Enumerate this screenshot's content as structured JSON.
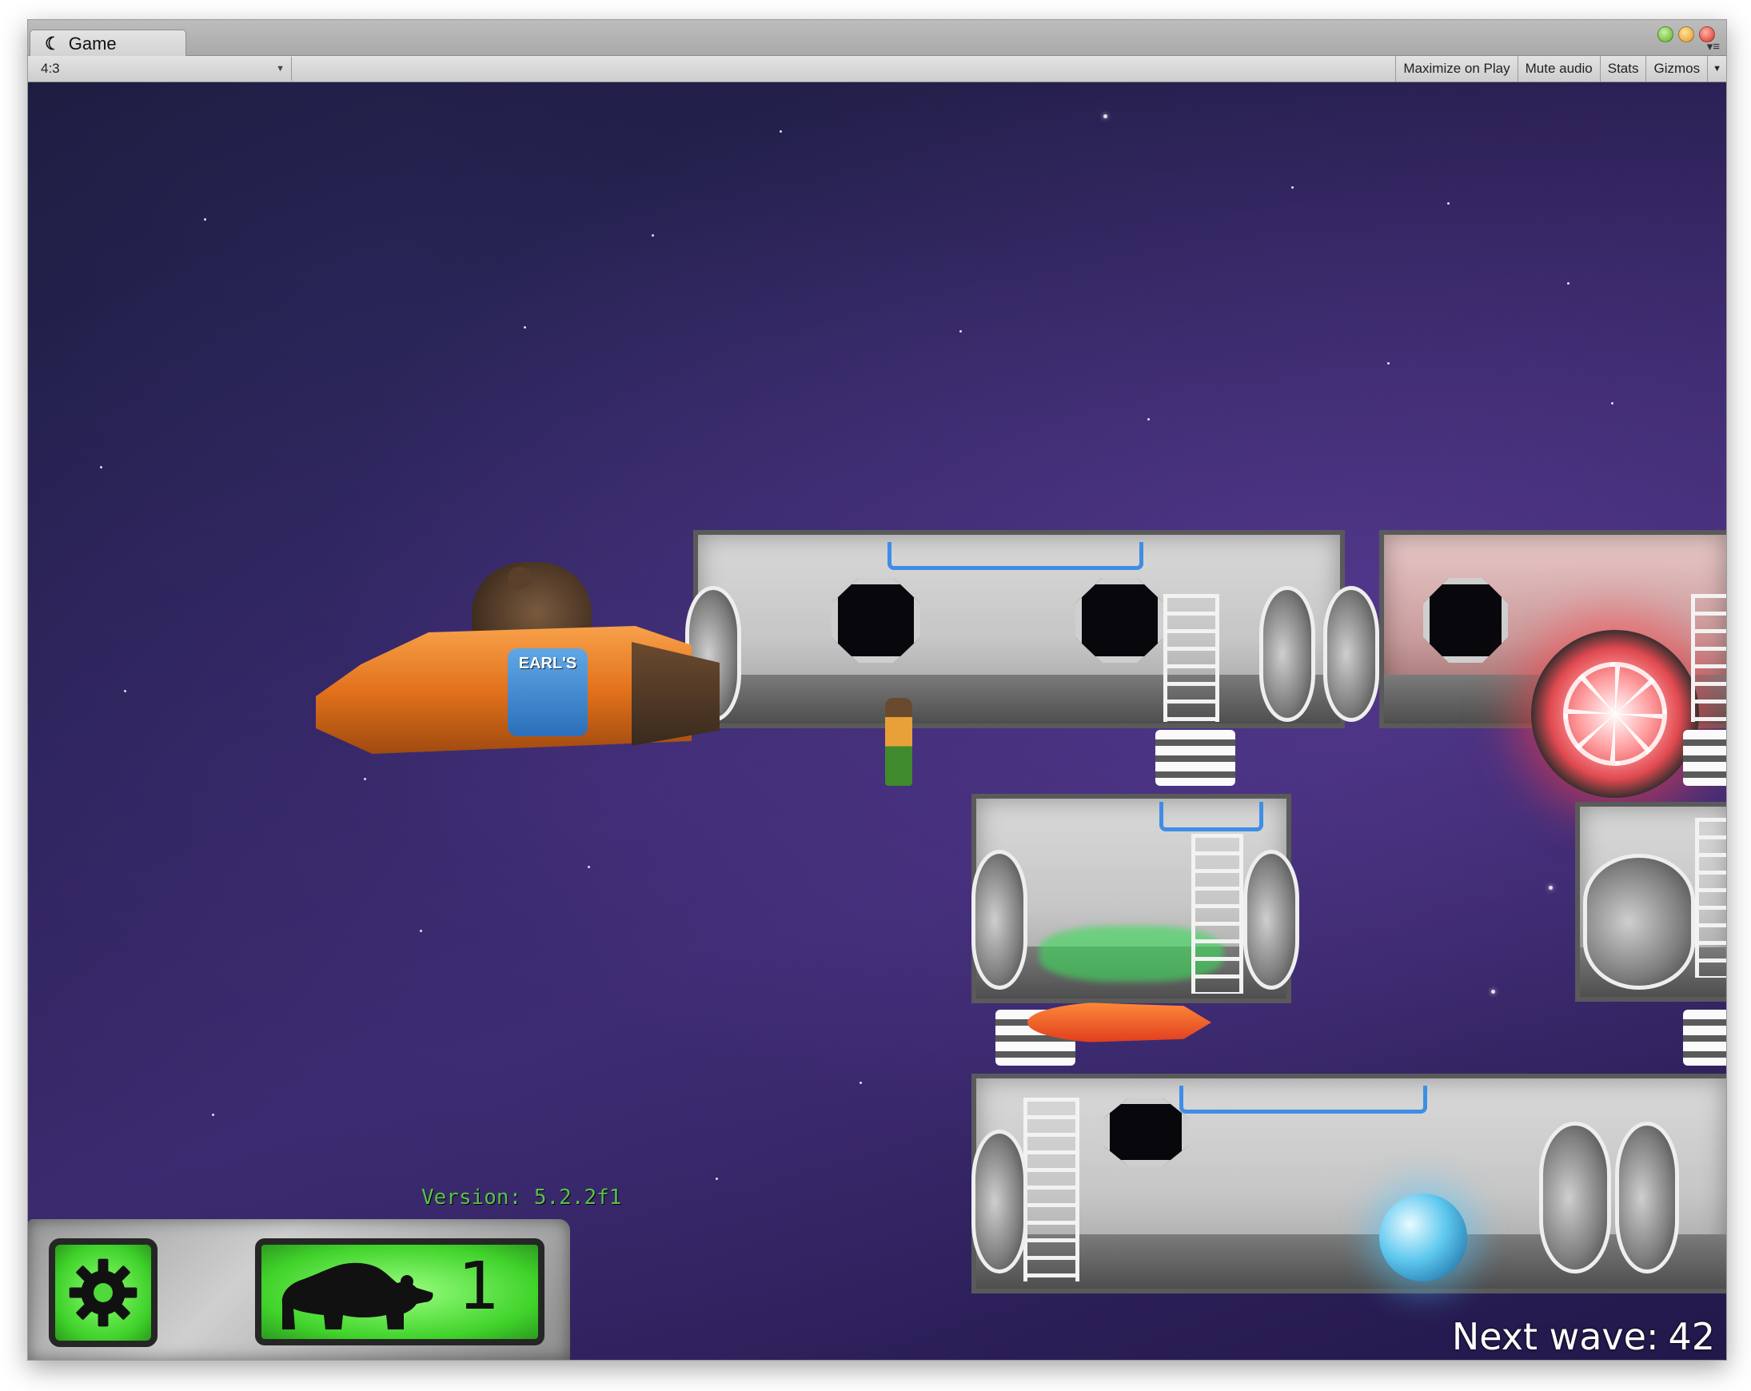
{
  "window": {
    "tab_title": "Game",
    "tab_icon": "unity-logo-icon"
  },
  "toolbar": {
    "aspect_value": "4:3",
    "maximize_on_play": "Maximize on Play",
    "mute_audio": "Mute audio",
    "stats": "Stats",
    "gizmos": "Gizmos"
  },
  "game": {
    "ship_logo_text": "EARL'S"
  },
  "hud": {
    "version_text": "Version: 5.2.2f1",
    "bear_count": "1",
    "next_wave_label": "Next wave:",
    "next_wave_value": "42"
  },
  "colors": {
    "hud_green": "#41d32b",
    "version_green": "#58c24a",
    "space_purple": "#3b2a6e",
    "ship_orange": "#e3721c",
    "fan_red": "#e04a50"
  }
}
